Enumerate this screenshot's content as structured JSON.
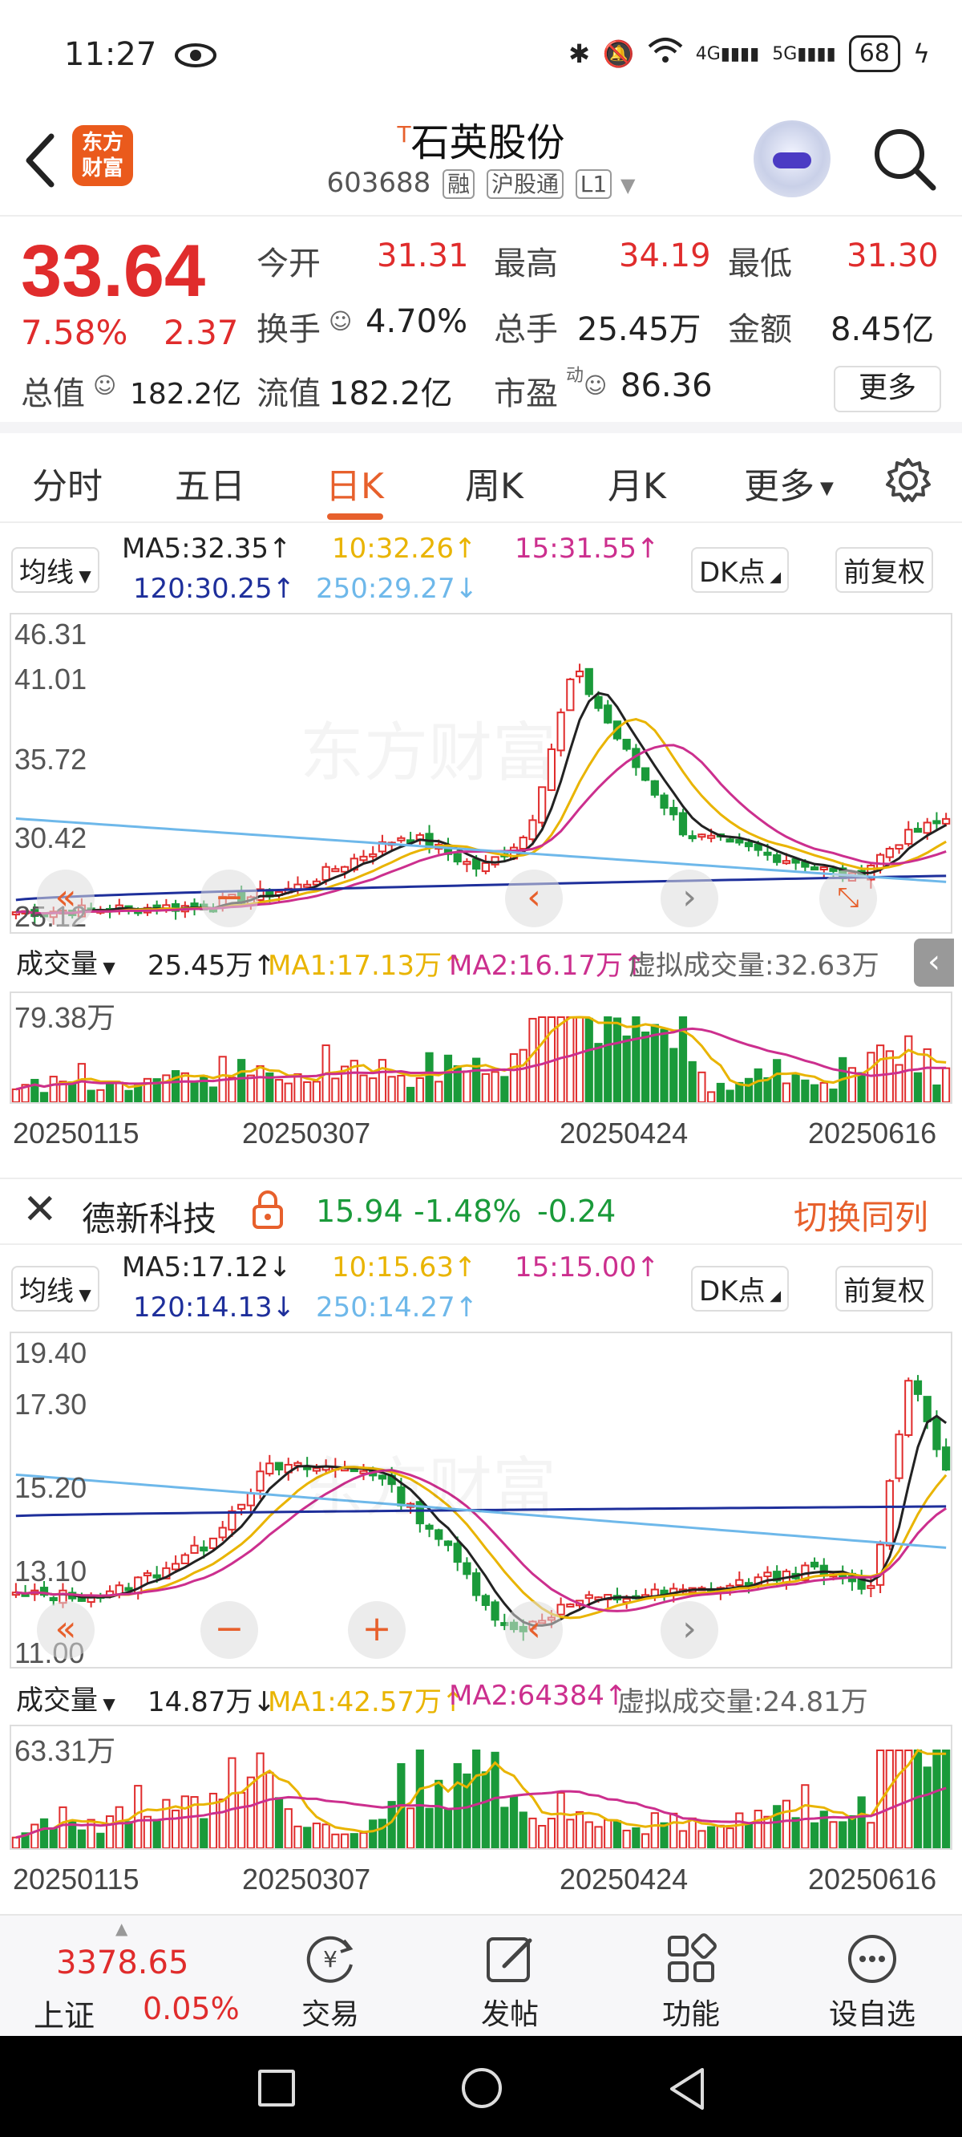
{
  "status": {
    "time": "11:27",
    "battery": "68"
  },
  "header": {
    "logo_line1": "东方",
    "logo_line2": "财富",
    "superscript": "T",
    "stock_name": "石英股份",
    "stock_code": "603688",
    "tags": [
      "融",
      "沪股通",
      "L1"
    ]
  },
  "quote": {
    "price": "33.64",
    "pct": "7.58%",
    "change": "2.37",
    "open_label": "今开",
    "open": "31.31",
    "high_label": "最高",
    "high": "34.19",
    "low_label": "最低",
    "low": "31.30",
    "turnover_label": "换手",
    "turnover": "4.70%",
    "volume_label": "总手",
    "volume": "25.45万",
    "amount_label": "金额",
    "amount": "8.45亿",
    "mktcap_label": "总值",
    "mktcap": "182.2亿",
    "float_label": "流值",
    "float_cap": "182.2亿",
    "pe_label": "市盈",
    "pe_super": "动",
    "pe": "86.36",
    "more": "更多"
  },
  "tabs": [
    "分时",
    "五日",
    "日K",
    "周K",
    "月K",
    "更多"
  ],
  "chart1": {
    "ma_select": "均线",
    "ma5": "MA5:32.35↑",
    "ma10": "10:32.26↑",
    "ma15": "15:31.55↑",
    "ma120": "120:30.25↑",
    "ma250": "250:29.27↓",
    "dk": "DK点",
    "adjust": "前复权",
    "y_labels": [
      "46.31",
      "41.01",
      "35.72",
      "30.42",
      "25.12"
    ],
    "vol_select": "成交量",
    "vol_value": "25.45万↑",
    "vol_ma1": "MA1:17.13万↑",
    "vol_ma2": "MA2:16.17万↑",
    "vol_virtual": "虚拟成交量:32.63万",
    "vol_max": "79.38万",
    "dates": [
      "20250115",
      "20250307",
      "20250424",
      "20250616"
    ]
  },
  "compare": {
    "name": "德新科技",
    "price": "15.94",
    "pct": "-1.48%",
    "change": "-0.24",
    "switch": "切换同列"
  },
  "chart2": {
    "ma_select": "均线",
    "ma5": "MA5:17.12↓",
    "ma10": "10:15.63↑",
    "ma15": "15:15.00↑",
    "ma120": "120:14.13↓",
    "ma250": "250:14.27↑",
    "dk": "DK点",
    "adjust": "前复权",
    "y_labels": [
      "19.40",
      "17.30",
      "15.20",
      "13.10",
      "11.00"
    ],
    "vol_select": "成交量",
    "vol_value": "14.87万↓",
    "vol_ma1": "MA1:42.57万↑",
    "vol_ma2": "MA2:64384↑",
    "vol_virtual": "虚拟成交量:24.81万",
    "vol_max": "63.31万",
    "dates": [
      "20250115",
      "20250307",
      "20250424",
      "20250616"
    ]
  },
  "bottomnav": {
    "index_value": "3378.65",
    "index_name": "上证",
    "index_pct": "0.05%",
    "items": [
      "交易",
      "发帖",
      "功能",
      "设自选"
    ]
  },
  "watermark": "东方财富",
  "colors": {
    "up": "#e02c2c",
    "down": "#1a9a3a",
    "accent": "#e7602c",
    "ma5": "#222222",
    "ma10": "#e9b400",
    "ma15": "#cc2f8e",
    "ma120": "#1e2f9b",
    "ma250": "#6eb8ea"
  }
}
